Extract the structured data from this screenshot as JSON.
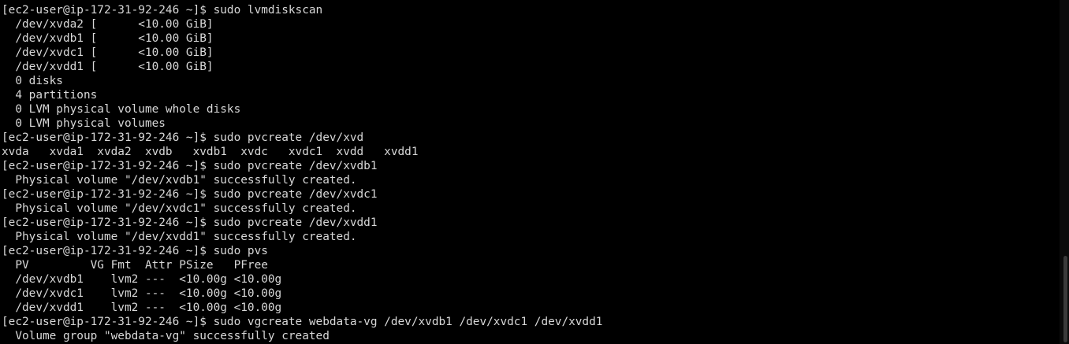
{
  "terminal": {
    "lines": [
      "[ec2-user@ip-172-31-92-246 ~]$ sudo lvmdiskscan",
      "  /dev/xvda2 [      <10.00 GiB]",
      "  /dev/xvdb1 [      <10.00 GiB]",
      "  /dev/xvdc1 [      <10.00 GiB]",
      "  /dev/xvdd1 [      <10.00 GiB]",
      "  0 disks",
      "  4 partitions",
      "  0 LVM physical volume whole disks",
      "  0 LVM physical volumes",
      "[ec2-user@ip-172-31-92-246 ~]$ sudo pvcreate /dev/xvd",
      "xvda   xvda1  xvda2  xvdb   xvdb1  xvdc   xvdc1  xvdd   xvdd1",
      "[ec2-user@ip-172-31-92-246 ~]$ sudo pvcreate /dev/xvdb1",
      "  Physical volume \"/dev/xvdb1\" successfully created.",
      "[ec2-user@ip-172-31-92-246 ~]$ sudo pvcreate /dev/xvdc1",
      "  Physical volume \"/dev/xvdc1\" successfully created.",
      "[ec2-user@ip-172-31-92-246 ~]$ sudo pvcreate /dev/xvdd1",
      "  Physical volume \"/dev/xvdd1\" successfully created.",
      "[ec2-user@ip-172-31-92-246 ~]$ sudo pvs",
      "  PV         VG Fmt  Attr PSize   PFree",
      "  /dev/xvdb1    lvm2 ---  <10.00g <10.00g",
      "  /dev/xvdc1    lvm2 ---  <10.00g <10.00g",
      "  /dev/xvdd1    lvm2 ---  <10.00g <10.00g",
      "[ec2-user@ip-172-31-92-246 ~]$ sudo vgcreate webdata-vg /dev/xvdb1 /dev/xvdc1 /dev/xvdd1",
      "  Volume group \"webdata-vg\" successfully created"
    ]
  },
  "colors": {
    "background": "#000000",
    "foreground": "#d8d8d8"
  }
}
